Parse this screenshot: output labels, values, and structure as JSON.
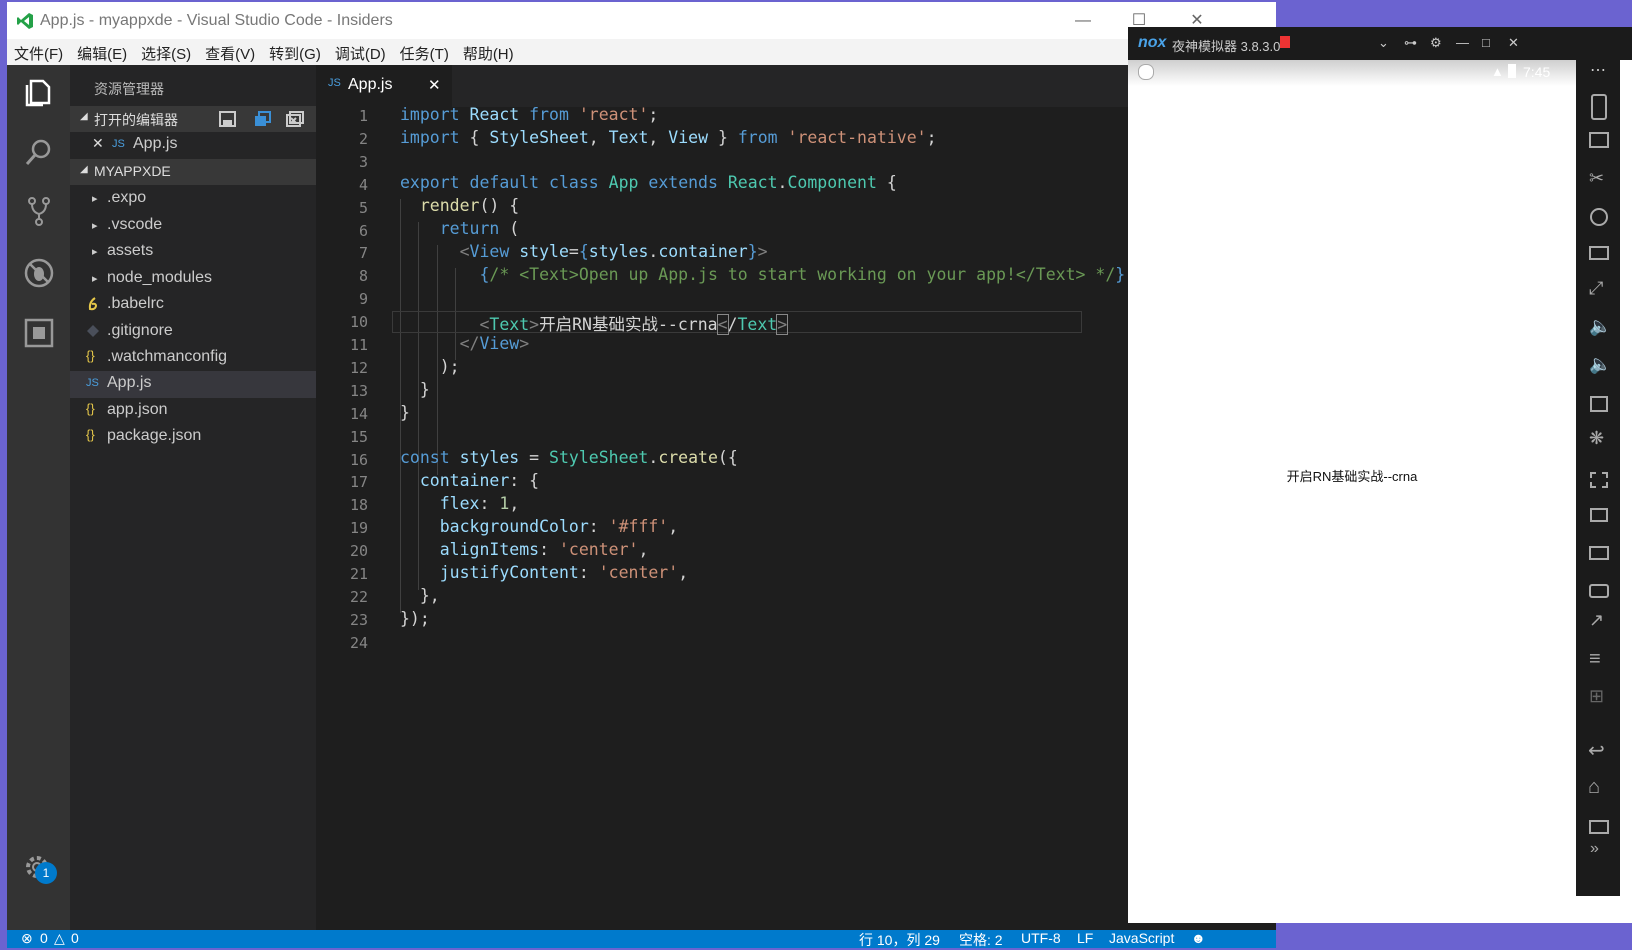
{
  "vscode": {
    "title": "App.js - myappxde - Visual Studio Code - Insiders",
    "menu": [
      "文件(F)",
      "编辑(E)",
      "选择(S)",
      "查看(V)",
      "转到(G)",
      "调试(D)",
      "任务(T)",
      "帮助(H)"
    ],
    "explorer_title": "资源管理器",
    "open_editors_label": "打开的编辑器",
    "open_editor_file": "App.js",
    "project_label": "MYAPPXDE",
    "tree": [
      {
        "name": ".expo",
        "kind": "folder"
      },
      {
        "name": ".vscode",
        "kind": "folder"
      },
      {
        "name": "assets",
        "kind": "folder"
      },
      {
        "name": "node_modules",
        "kind": "folder"
      },
      {
        "name": ".babelrc",
        "kind": "babel"
      },
      {
        "name": ".gitignore",
        "kind": "git"
      },
      {
        "name": ".watchmanconfig",
        "kind": "json"
      },
      {
        "name": "App.js",
        "kind": "js",
        "selected": true
      },
      {
        "name": "app.json",
        "kind": "json"
      },
      {
        "name": "package.json",
        "kind": "json"
      }
    ],
    "tab_label": "App.js",
    "tab_icon_text": "JS",
    "js_badge": "JS",
    "json_badge": "{}",
    "settings_badge": "1",
    "status": {
      "errors": "0",
      "warnings": "0",
      "position": "行 10，列 29",
      "indent": "空格: 2",
      "encoding": "UTF-8",
      "eol": "LF",
      "language": "JavaScript"
    },
    "line_count": 24
  },
  "nox": {
    "title": "夜神模拟器 3.8.3.0",
    "logo": "nox",
    "time": "7:45",
    "app_text": "开启RN基础实战--crna"
  }
}
